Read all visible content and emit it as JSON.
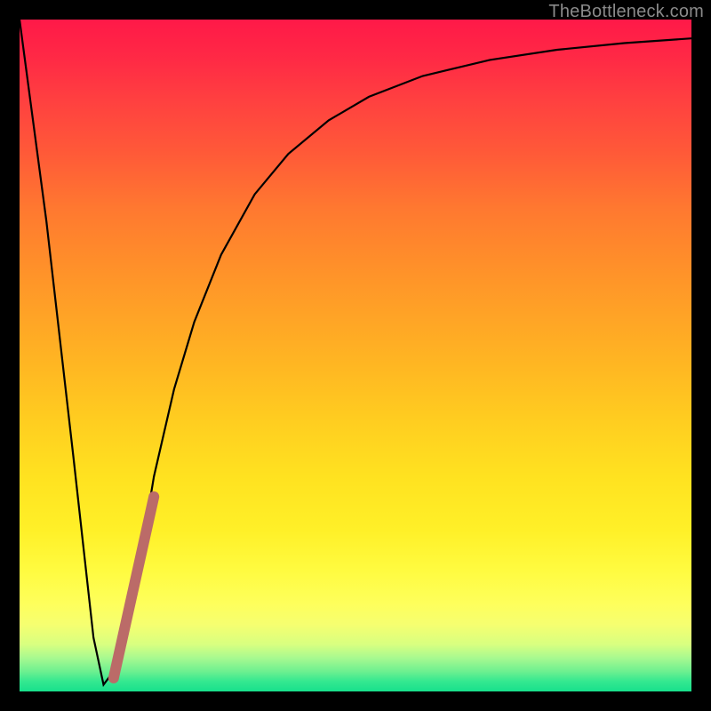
{
  "watermark": "TheBottleneck.com",
  "chart_data": {
    "type": "line",
    "title": "",
    "xlabel": "",
    "ylabel": "",
    "xlim": [
      0,
      1
    ],
    "ylim": [
      0,
      1
    ],
    "series": [
      {
        "name": "bottleneck-curve",
        "x": [
          0.0,
          0.04,
          0.08,
          0.11,
          0.125,
          0.14,
          0.16,
          0.18,
          0.2,
          0.23,
          0.26,
          0.3,
          0.35,
          0.4,
          0.46,
          0.52,
          0.6,
          0.7,
          0.8,
          0.9,
          1.0
        ],
        "y": [
          1.0,
          0.7,
          0.35,
          0.08,
          0.01,
          0.03,
          0.1,
          0.2,
          0.32,
          0.45,
          0.55,
          0.65,
          0.74,
          0.8,
          0.85,
          0.885,
          0.916,
          0.94,
          0.955,
          0.965,
          0.972
        ]
      },
      {
        "name": "marker-segment",
        "x": [
          0.14,
          0.2
        ],
        "y": [
          0.02,
          0.29
        ]
      }
    ],
    "gradient_stops": [
      {
        "offset": 0.0,
        "color": "#ff1948"
      },
      {
        "offset": 0.5,
        "color": "#ffb822"
      },
      {
        "offset": 0.85,
        "color": "#feff5c"
      },
      {
        "offset": 1.0,
        "color": "#18e08c"
      }
    ]
  }
}
